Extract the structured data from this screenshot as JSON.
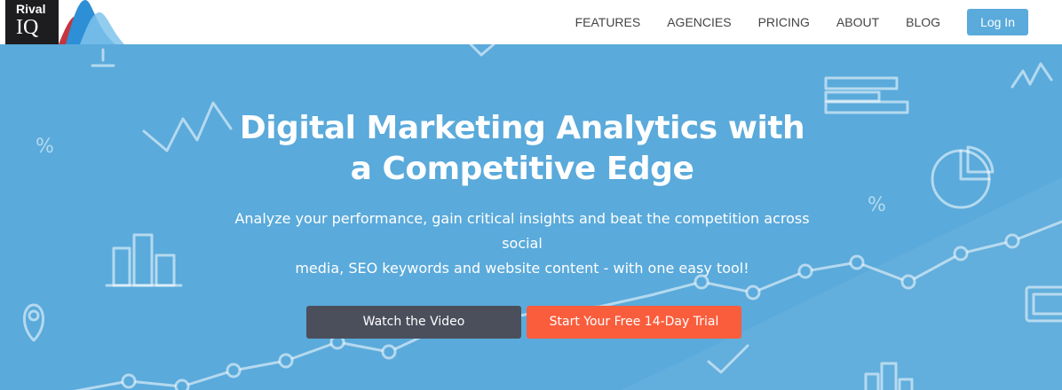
{
  "brand": {
    "logo_top": "Rival",
    "logo_bottom": "IQ"
  },
  "nav": {
    "items": [
      {
        "label": "FEATURES"
      },
      {
        "label": "AGENCIES"
      },
      {
        "label": "PRICING"
      },
      {
        "label": "ABOUT"
      },
      {
        "label": "BLOG"
      }
    ],
    "login_label": "Log In"
  },
  "hero": {
    "title_line1": "Digital Marketing Analytics with",
    "title_line2": "a Competitive Edge",
    "subtitle_line1": "Analyze your performance, gain critical insights and beat the competition across social",
    "subtitle_line2": "media, SEO keywords and website content - with one easy tool!",
    "video_button": "Watch the Video",
    "trial_button": "Start Your Free 14-Day Trial",
    "percent_left": "%",
    "percent_right": "%"
  },
  "colors": {
    "hero_bg": "#5aaadb",
    "login_bg": "#5aaadb",
    "video_button_bg": "#4b4f5c",
    "trial_button_bg": "#fa5d3c",
    "logo_bg": "#1d1d1f"
  }
}
